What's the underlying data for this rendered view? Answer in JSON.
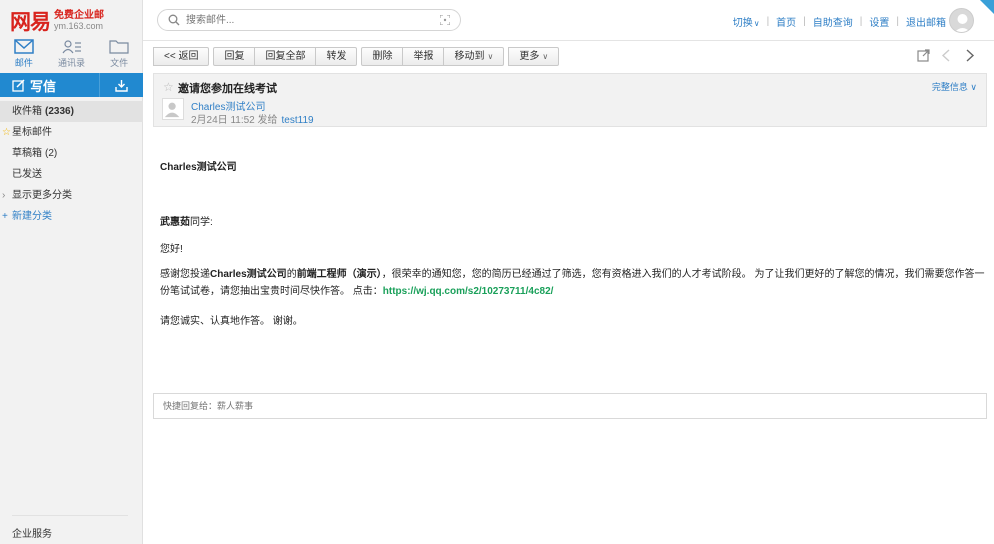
{
  "logo": {
    "brand": "网易",
    "title": "免费企业邮",
    "domain": "ym.163.com"
  },
  "nav": {
    "mail": "邮件",
    "contacts": "通讯录",
    "files": "文件"
  },
  "compose": {
    "label": "写信"
  },
  "folders": {
    "inbox": {
      "label": "收件箱",
      "count": "(2336)"
    },
    "starred": {
      "label": "星标邮件"
    },
    "drafts": {
      "label": "草稿箱",
      "count": "(2)"
    },
    "sent": {
      "label": "已发送"
    },
    "more": {
      "label": "显示更多分类"
    },
    "new": {
      "label": "新建分类"
    }
  },
  "enterprise": "企业服务",
  "search": {
    "placeholder": "搜索邮件..."
  },
  "top_links": {
    "switch": "切换",
    "home": "首页",
    "selfhelp": "自助查询",
    "settings": "设置",
    "logout": "退出邮箱"
  },
  "toolbar": {
    "back": "<< 返回",
    "reply": "回复",
    "reply_all": "回复全部",
    "forward": "转发",
    "delete": "删除",
    "report": "举报",
    "move_to": "移动到",
    "more": "更多"
  },
  "mail": {
    "subject": "邀请您参加在线考试",
    "full_info": "完整信息",
    "sender": "Charles测试公司",
    "date": "2月24日 11:52 发给",
    "to": "test119",
    "body": {
      "company": "Charles测试公司",
      "name": "武惠茹",
      "name_suffix": "同学:",
      "hello": "您好!",
      "p1_a": "感谢您投递",
      "p1_company": "Charles测试公司",
      "p1_b": "的",
      "p1_job": "前端工程师（演示）",
      "p1_c": "，很荣幸的通知您，您的简历已经通过了筛选，您有资格进入我们的人才考试阶段。 为了让我们更好的了解您的情况，我们需要您作答一份笔试试卷，请您抽出宝贵时间尽快作答。 点击：",
      "p1_link": "https://wj.qq.com/s2/10273711/4c82/",
      "closing": "请您诚实、认真地作答。 谢谢。"
    }
  },
  "quick_reply": {
    "placeholder": "快捷回复给：薪人薪事"
  }
}
